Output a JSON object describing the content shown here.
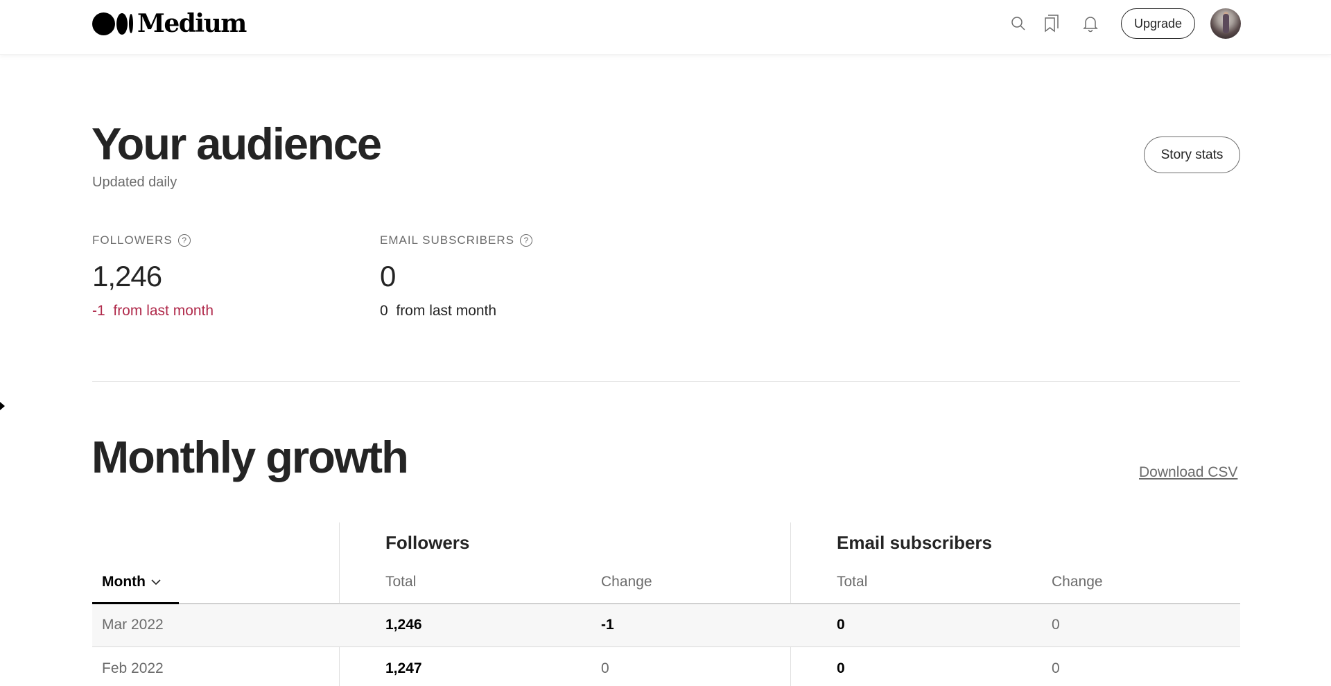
{
  "header": {
    "brand": "Medium",
    "icons": [
      "search-icon",
      "bookmarks-icon",
      "notifications-bell-icon"
    ],
    "upgrade_label": "Upgrade"
  },
  "audience": {
    "title": "Your audience",
    "subtitle": "Updated daily",
    "story_stats_label": "Story stats",
    "followers": {
      "label": "FOLLOWERS",
      "value": "1,246",
      "change_value": "-1",
      "change_text": "from last month"
    },
    "email_subscribers": {
      "label": "EMAIL SUBSCRIBERS",
      "value": "0",
      "change_value": "0",
      "change_text": "from last month"
    }
  },
  "monthly_growth": {
    "title": "Monthly growth",
    "download_label": "Download CSV",
    "columns": {
      "month": "Month",
      "followers_group": "Followers",
      "email_group": "Email subscribers",
      "total": "Total",
      "change": "Change"
    },
    "rows": [
      {
        "month": "Mar 2022",
        "followers_total": "1,246",
        "followers_change": "-1",
        "email_total": "0",
        "email_change": "0"
      },
      {
        "month": "Feb 2022",
        "followers_total": "1,247",
        "followers_change": "0",
        "email_total": "0",
        "email_change": "0"
      }
    ]
  },
  "colors": {
    "negative": "#b02a4b",
    "text": "#242424",
    "muted": "#6b6b6b"
  }
}
